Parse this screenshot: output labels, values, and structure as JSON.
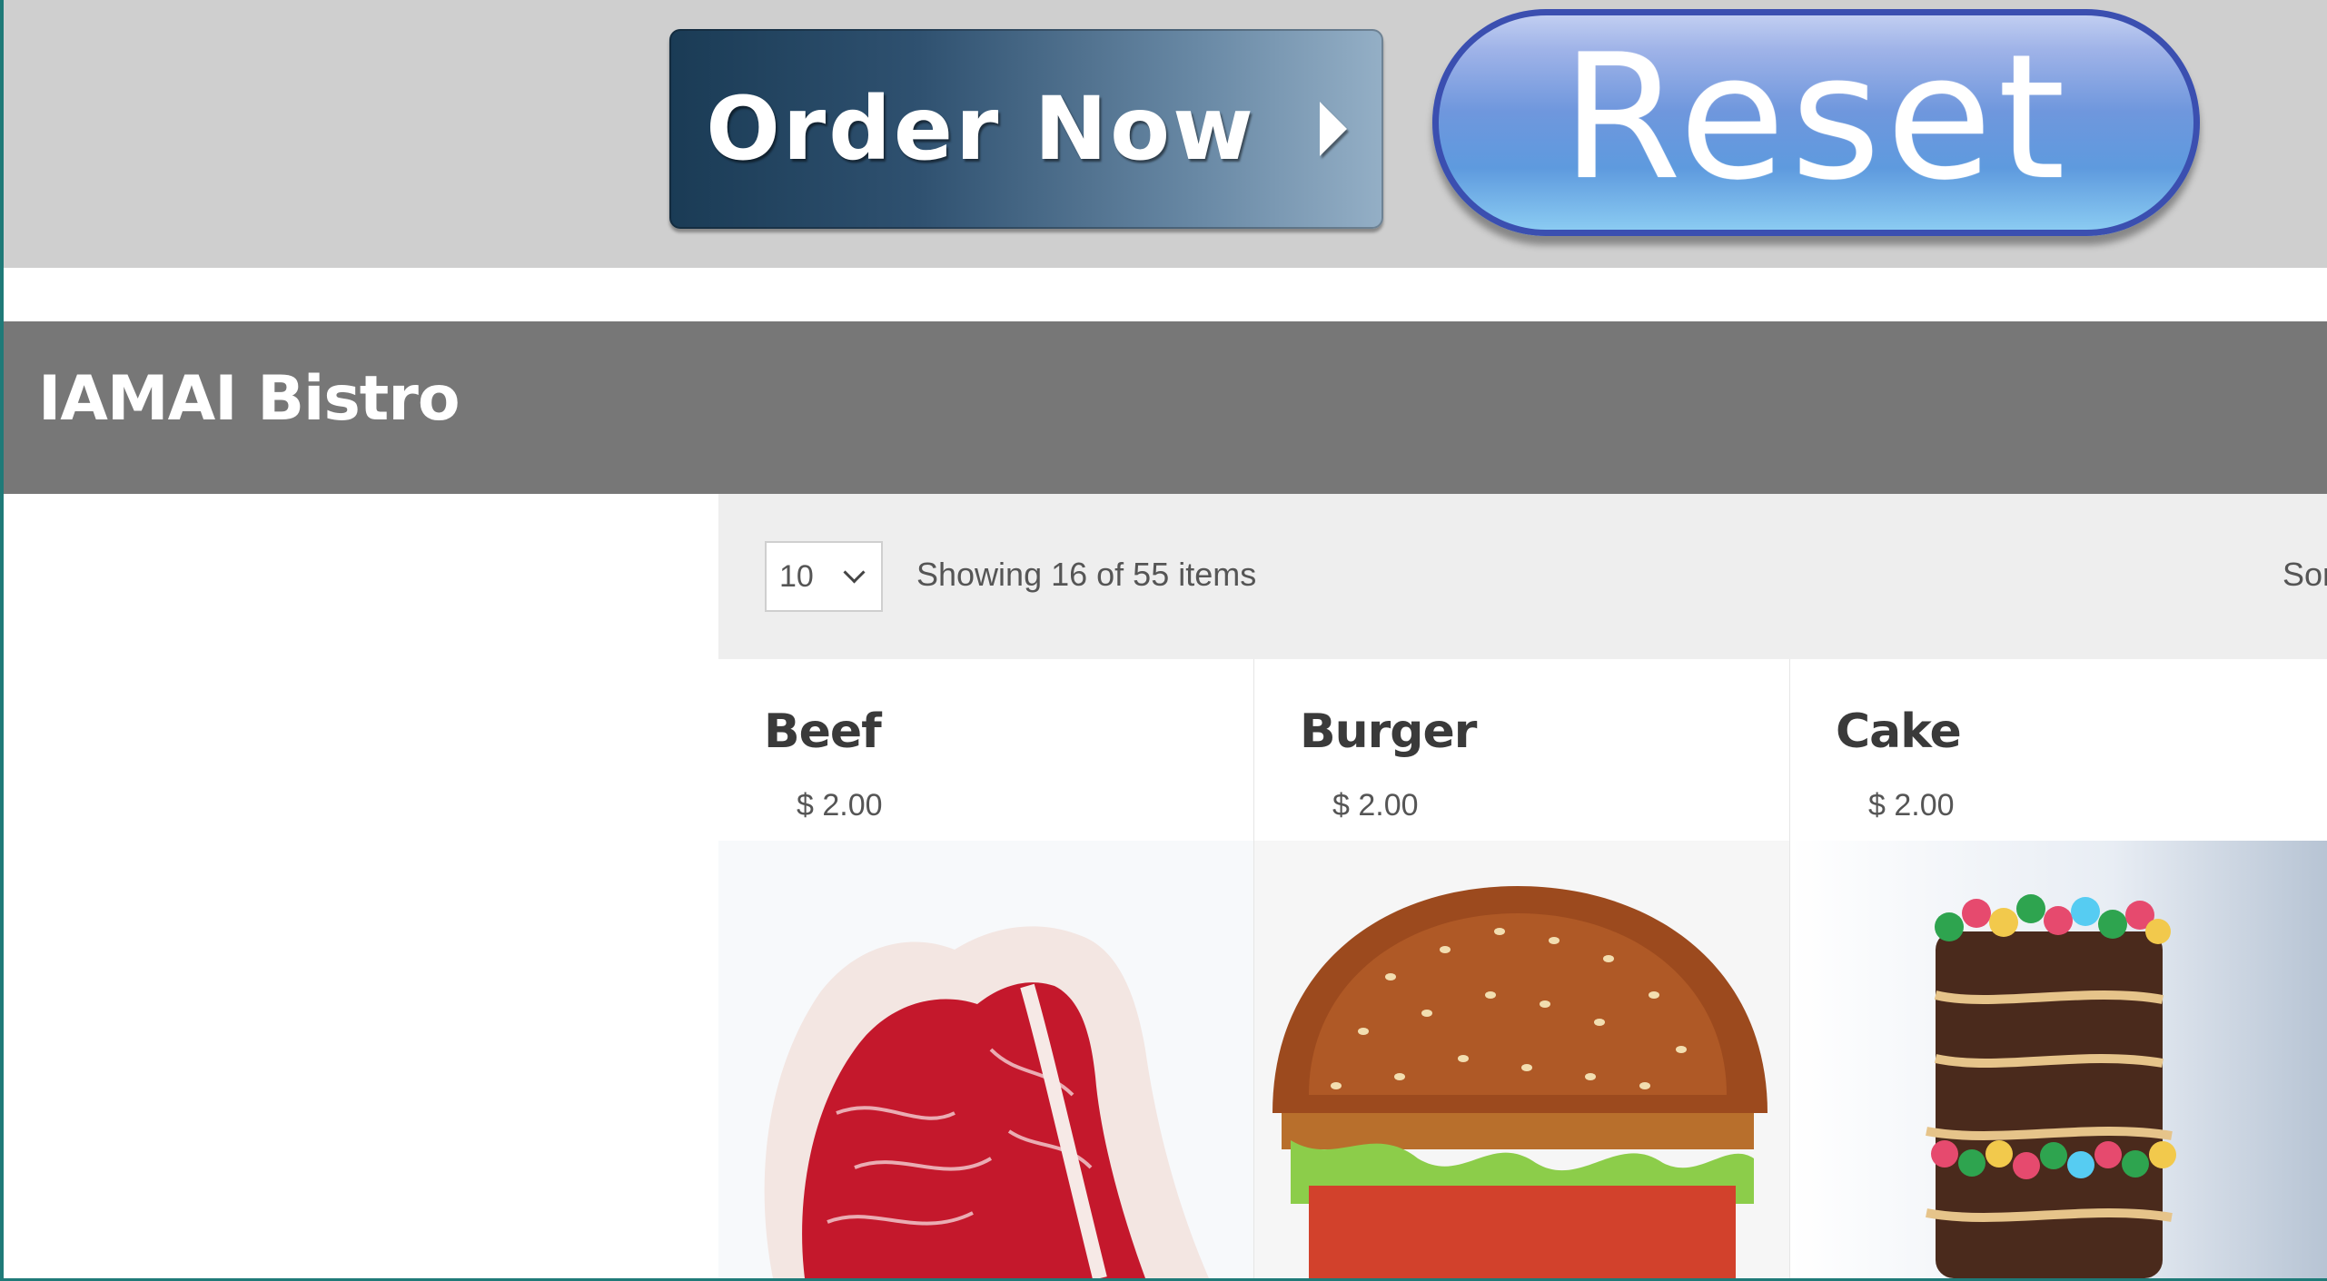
{
  "toolbar": {
    "order_label": "Order Now",
    "reset_label": "Reset"
  },
  "header": {
    "title": "IAMAI Bistro"
  },
  "list": {
    "page_size": "10",
    "showing_text": "Showing 16 of 55 items",
    "sort_label": "Sor"
  },
  "products": [
    {
      "name": "Beef",
      "price": "$ 2.00",
      "image": "beef-steak"
    },
    {
      "name": "Burger",
      "price": "$ 2.00",
      "image": "burger"
    },
    {
      "name": "Cake",
      "price": "$ 2.00",
      "image": "layer-cake"
    }
  ],
  "colors": {
    "topbar": "#cfcfcf",
    "header": "#777777",
    "listbar": "#eeeeee",
    "frame_accent": "#1f7a78",
    "reset_blue": "#5e9ade",
    "order_navy": "#1a3b55"
  }
}
